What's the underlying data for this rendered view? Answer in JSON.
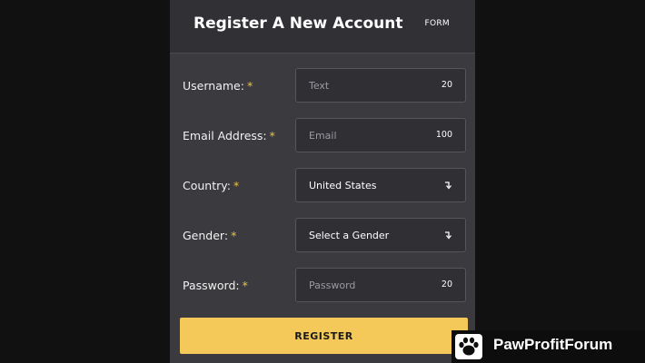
{
  "header": {
    "title": "Register A New Account",
    "tag": "FORM"
  },
  "form": {
    "required_marker": "*",
    "username": {
      "label": "Username:",
      "placeholder": "Text",
      "counter": "20"
    },
    "email": {
      "label": "Email Address:",
      "placeholder": "Email",
      "counter": "100"
    },
    "country": {
      "label": "Country:",
      "value": "United States"
    },
    "gender": {
      "label": "Gender:",
      "value": "Select a Gender"
    },
    "password": {
      "label": "Password:",
      "placeholder": "Password",
      "counter": "20"
    },
    "submit_label": "REGISTER"
  },
  "watermark": {
    "text": "PawProfitForum",
    "icon": "paw-icon"
  },
  "colors": {
    "accent": "#f4c95a",
    "required": "#f0c040",
    "panel": "#3a3a3f",
    "field": "#2f2f34",
    "background": "#111111"
  }
}
